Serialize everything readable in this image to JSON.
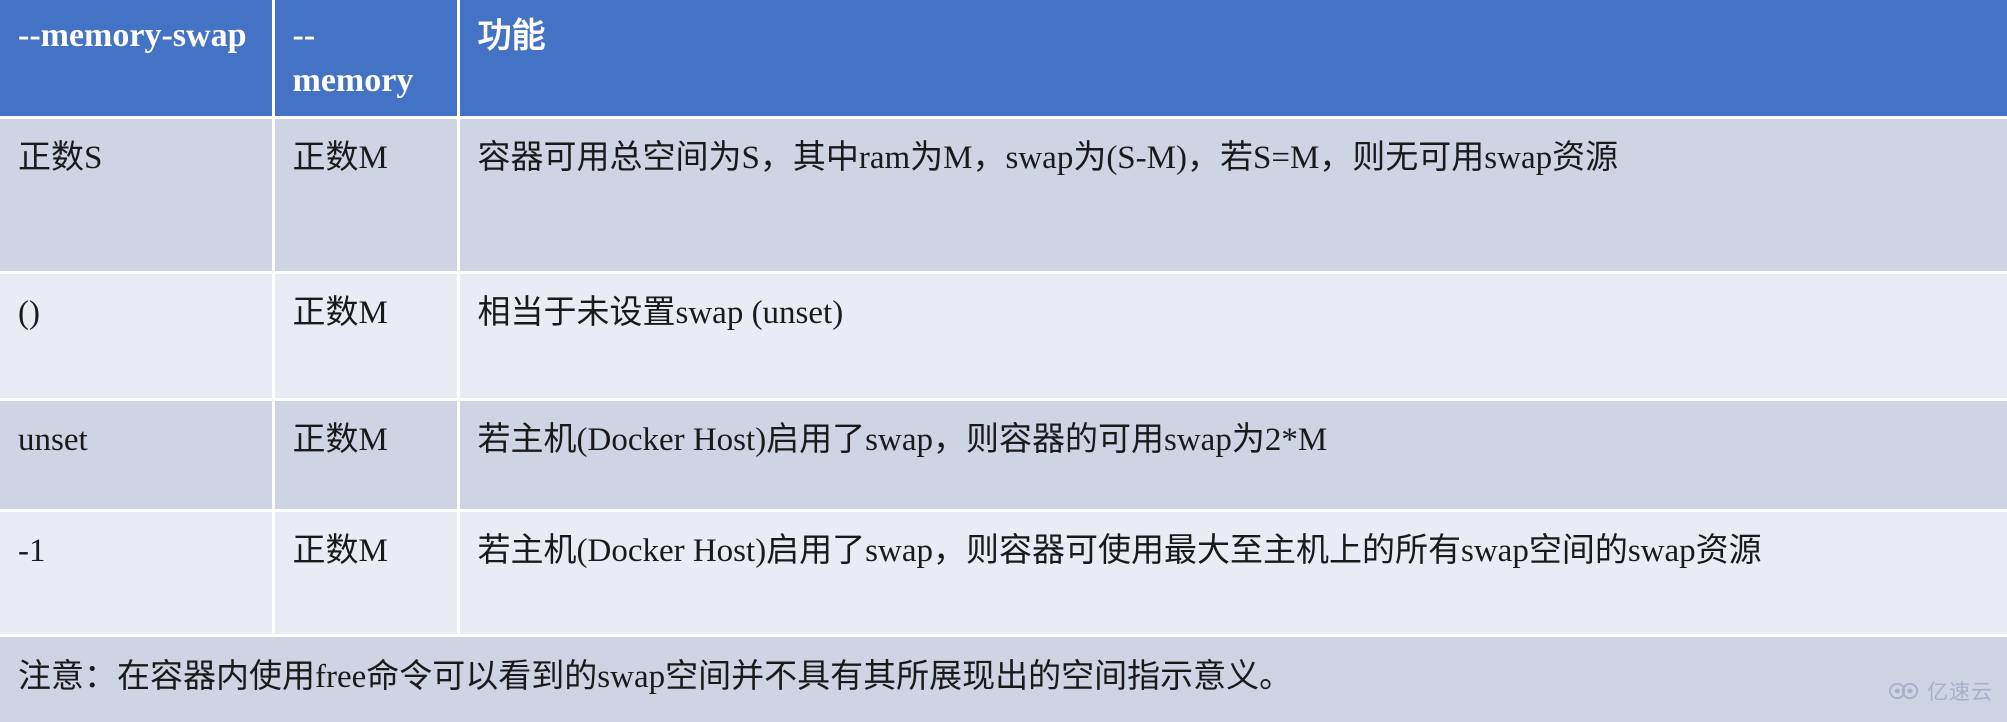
{
  "table": {
    "columns": [
      {
        "id": "memory-swap",
        "label": "--memory-swap"
      },
      {
        "id": "memory",
        "label": "--\nmemory"
      },
      {
        "id": "function",
        "label": "功能"
      }
    ],
    "column_labels": {
      "memory_swap": "--memory-swap",
      "memory": "--",
      "memory_second_line": "memory",
      "function": "功能"
    },
    "rows": [
      {
        "memory_swap": "正数S",
        "memory": "正数M",
        "function": "容器可用总空间为S，其中ram为M，swap为(S-M)，若S=M，则无可用swap资源"
      },
      {
        "memory_swap": "()",
        "memory": "正数M",
        "function": "相当于未设置swap (unset)"
      },
      {
        "memory_swap": "unset",
        "memory": "正数M",
        "function": "若主机(Docker Host)启用了swap，则容器的可用swap为2*M"
      },
      {
        "memory_swap": "-1",
        "memory": "正数M",
        "function": "若主机(Docker Host)启用了swap，则容器可使用最大至主机上的所有swap空间的swap资源"
      }
    ],
    "note": "注意：在容器内使用free命令可以看到的swap空间并不具有其所展现出的空间指示意义。"
  },
  "watermark": {
    "text": "亿速云",
    "icon": "cloud-icon"
  },
  "colors": {
    "header_background": "#4472C4",
    "header_text": "#FFFFFF",
    "row_shade_dark": "#CED4E4",
    "row_shade_light": "#E9ECF4",
    "body_text": "#1A1A1A",
    "watermark_text": "#9AA4C3"
  }
}
